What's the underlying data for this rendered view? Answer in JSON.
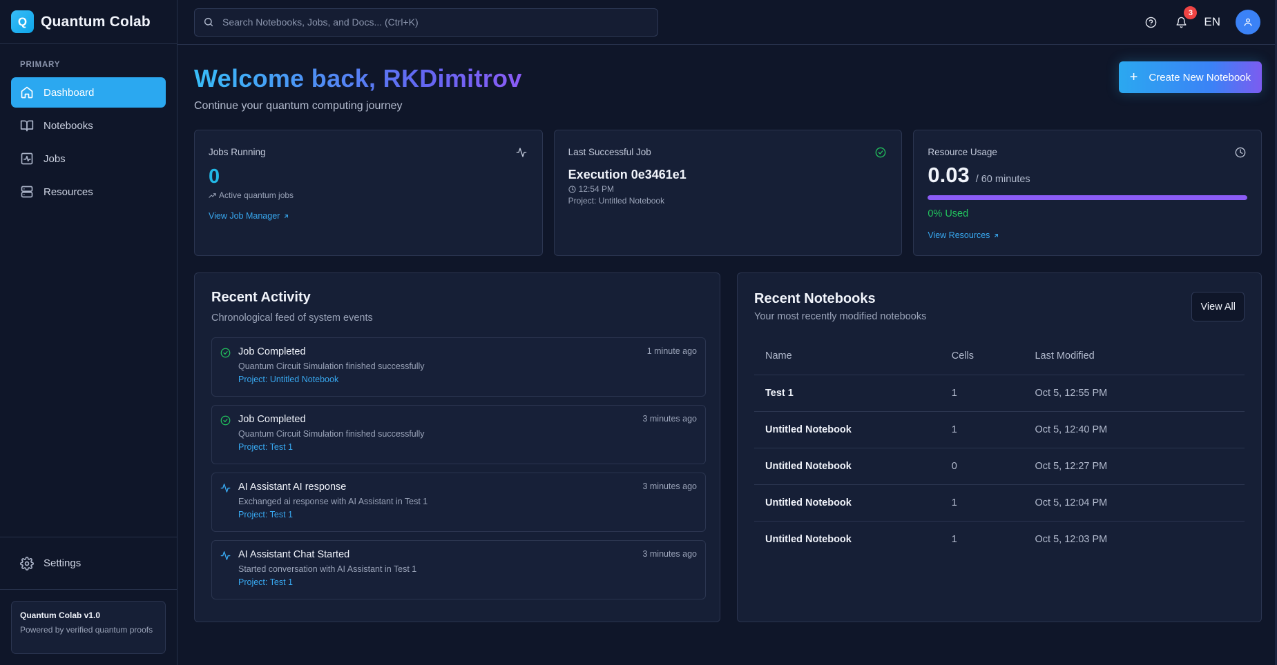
{
  "brand": {
    "logo_letter": "Q",
    "name": "Quantum Colab"
  },
  "sidebar": {
    "section_heading": "PRIMARY",
    "items": [
      {
        "label": "Dashboard",
        "icon": "home-icon",
        "active": true
      },
      {
        "label": "Notebooks",
        "icon": "book-icon",
        "active": false
      },
      {
        "label": "Jobs",
        "icon": "activity-icon",
        "active": false
      },
      {
        "label": "Resources",
        "icon": "server-icon",
        "active": false
      }
    ],
    "settings_label": "Settings",
    "version_title": "Quantum Colab v1.0",
    "version_sub": "Powered by verified quantum proofs"
  },
  "topbar": {
    "search_placeholder": "Search Notebooks, Jobs, and Docs... (Ctrl+K)",
    "notification_count": "3",
    "language": "EN"
  },
  "header": {
    "welcome": "Welcome back, RKDimitrov",
    "subtitle": "Continue your quantum computing journey",
    "create_button": "Create New Notebook"
  },
  "stats": {
    "jobs_running": {
      "label": "Jobs Running",
      "value": "0",
      "caption": "Active quantum jobs",
      "link": "View Job Manager"
    },
    "last_job": {
      "label": "Last Successful Job",
      "title": "Execution 0e3461e1",
      "time": "12:54 PM",
      "project": "Project: Untitled Notebook"
    },
    "resource_usage": {
      "label": "Resource Usage",
      "value": "0.03",
      "total": "/ 60 minutes",
      "bar_fraction": 1.0,
      "used_label": "0% Used",
      "link": "View Resources"
    }
  },
  "activity": {
    "title": "Recent Activity",
    "subtitle": "Chronological feed of system events",
    "items": [
      {
        "type": "check-circle-icon",
        "title": "Job Completed",
        "description": "Quantum Circuit Simulation finished successfully",
        "project": "Project: Untitled Notebook",
        "time": "1 minute ago"
      },
      {
        "type": "check-circle-icon",
        "title": "Job Completed",
        "description": "Quantum Circuit Simulation finished successfully",
        "project": "Project: Test 1",
        "time": "3 minutes ago"
      },
      {
        "type": "activity-icon",
        "title": "AI Assistant AI response",
        "description": "Exchanged ai response with AI Assistant in Test 1",
        "project": "Project: Test 1",
        "time": "3 minutes ago"
      },
      {
        "type": "activity-icon",
        "title": "AI Assistant Chat Started",
        "description": "Started conversation with AI Assistant in Test 1",
        "project": "Project: Test 1",
        "time": "3 minutes ago"
      }
    ]
  },
  "notebooks": {
    "title": "Recent Notebooks",
    "subtitle": "Your most recently modified notebooks",
    "view_all": "View All",
    "columns": [
      "Name",
      "Cells",
      "Last Modified"
    ],
    "rows": [
      {
        "name": "Test 1",
        "cells": "1",
        "modified": "Oct 5, 12:55 PM"
      },
      {
        "name": "Untitled Notebook",
        "cells": "1",
        "modified": "Oct 5, 12:40 PM"
      },
      {
        "name": "Untitled Notebook",
        "cells": "0",
        "modified": "Oct 5, 12:27 PM"
      },
      {
        "name": "Untitled Notebook",
        "cells": "1",
        "modified": "Oct 5, 12:04 PM"
      },
      {
        "name": "Untitled Notebook",
        "cells": "1",
        "modified": "Oct 5, 12:03 PM"
      }
    ]
  },
  "colors": {
    "accent": "#2ba8f0",
    "success": "#22c55e",
    "progress": "#8b5cf6",
    "badge": "#ef4444"
  }
}
